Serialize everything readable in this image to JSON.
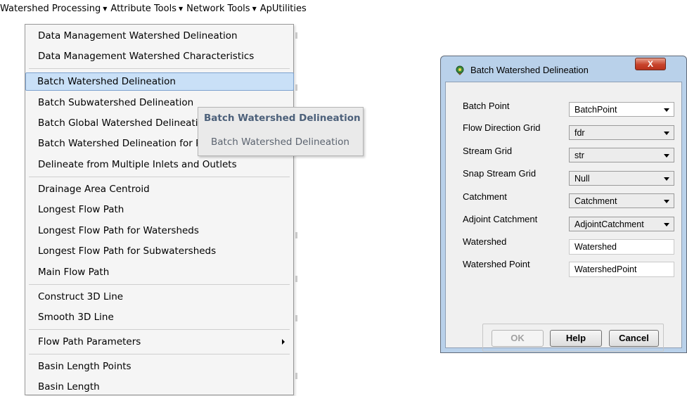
{
  "menubar": {
    "items": [
      {
        "label": "Watershed Processing",
        "has_dropdown": true
      },
      {
        "label": "Attribute Tools",
        "has_dropdown": true
      },
      {
        "label": "Network Tools",
        "has_dropdown": true
      },
      {
        "label": "ApUtilities",
        "has_dropdown": false
      }
    ]
  },
  "dropdown": {
    "items": [
      {
        "label": "Data Management Watershed Delineation"
      },
      {
        "label": "Data Management Watershed Characteristics"
      },
      {
        "label": "Batch Watershed Delineation",
        "highlighted": true
      },
      {
        "label": "Batch Subwatershed Delineation"
      },
      {
        "label": "Batch Global Watershed Delineation"
      },
      {
        "label": "Batch Watershed Delineation for Polygons"
      },
      {
        "label": "Delineate from Multiple Inlets and Outlets"
      },
      {
        "label": "Drainage Area Centroid"
      },
      {
        "label": "Longest Flow Path"
      },
      {
        "label": "Longest Flow Path for Watersheds"
      },
      {
        "label": "Longest Flow Path for Subwatersheds"
      },
      {
        "label": "Main Flow Path"
      },
      {
        "label": "Construct 3D Line"
      },
      {
        "label": "Smooth 3D Line"
      },
      {
        "label": "Flow Path Parameters",
        "submenu": true
      },
      {
        "label": "Basin Length Points"
      },
      {
        "label": "Basin Length"
      }
    ]
  },
  "tooltip": {
    "title": "Batch Watershed Delineation",
    "body": "Batch Watershed Delineation"
  },
  "dialog": {
    "title": "Batch Watershed Delineation",
    "close_label": "X",
    "fields": [
      {
        "label": "Batch Point",
        "value": "BatchPoint",
        "type": "combo"
      },
      {
        "label": "Flow Direction Grid",
        "value": "fdr",
        "type": "combo"
      },
      {
        "label": "Stream Grid",
        "value": "str",
        "type": "combo"
      },
      {
        "label": "Snap Stream Grid",
        "value": "Null",
        "type": "combo"
      },
      {
        "label": "Catchment",
        "value": "Catchment",
        "type": "combo"
      },
      {
        "label": "Adjoint Catchment",
        "value": "AdjointCatchment",
        "type": "combo"
      },
      {
        "label": "Watershed",
        "value": "Watershed",
        "type": "text"
      },
      {
        "label": "Watershed Point",
        "value": "WatershedPoint",
        "type": "text"
      }
    ],
    "buttons": {
      "ok": "OK",
      "help": "Help",
      "cancel": "Cancel"
    }
  },
  "colors": {
    "menu_highlight": "#c9e0f7",
    "dialog_frame": "#b9d1ea",
    "close_button": "#c8432b"
  }
}
